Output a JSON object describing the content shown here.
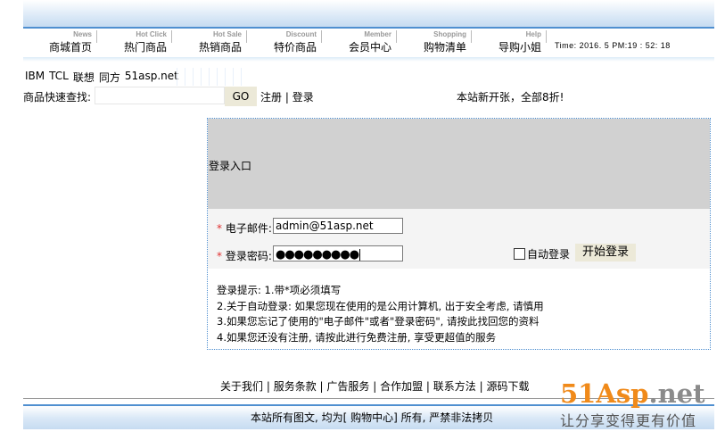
{
  "nav": {
    "items": [
      {
        "en": "News",
        "cn": "商城首页"
      },
      {
        "en": "Hot Click",
        "cn": "热门商品"
      },
      {
        "en": "Hot Sale",
        "cn": "热销商品"
      },
      {
        "en": "Discount",
        "cn": "特价商品"
      },
      {
        "en": "Member",
        "cn": "会员中心"
      },
      {
        "en": "Shopping",
        "cn": "购物清单"
      },
      {
        "en": "Help",
        "cn": "导购小姐"
      }
    ],
    "clock": "Time:  2016. 5 PM:19 :  52:  18"
  },
  "brands": [
    "IBM",
    "TCL",
    "联想",
    "同方",
    "51asp.net"
  ],
  "search": {
    "label": "商品快速查找:",
    "value": "",
    "go_label": "GO",
    "register_label": "注册",
    "divider": "|",
    "login_label": "登录",
    "notice": "本站新开张，全部8折!"
  },
  "login": {
    "title": "登录入口",
    "required_mark": "*",
    "email_label": "电子邮件:",
    "email_value": "admin@51asp.net",
    "password_label": "登录密码:",
    "password_mask": "●●●●●●●●●",
    "auto_login_label": "自动登录",
    "auto_login_checked": false,
    "submit_label": "开始登录",
    "tips": [
      "登录提示: 1.带*项必须填写",
      "2.关于自动登录: 如果您现在使用的是公用计算机, 出于安全考虑, 请慎用",
      "3.如果您忘记了使用的\"电子邮件\"或者\"登录密码\", 请按此找回您的资料",
      "4.如果您还没有注册, 请按此进行免费注册, 享受更超值的服务"
    ]
  },
  "footer": {
    "links": [
      "关于我们",
      "服务条款",
      "广告服务",
      "合作加盟",
      "联系方法",
      "源码下载"
    ],
    "separator": " | ",
    "copyright": "本站所有图文, 均为[ 购物中心] 所有, 严禁非法拷贝"
  },
  "watermark": {
    "brand_main": "51Asp",
    "brand_tail": ".net",
    "slogan": "让分享变得更有价值"
  },
  "colors": {
    "accent_blue": "#4f8fd0",
    "logo_orange": "#f08a1a",
    "required_red": "#e03030"
  }
}
